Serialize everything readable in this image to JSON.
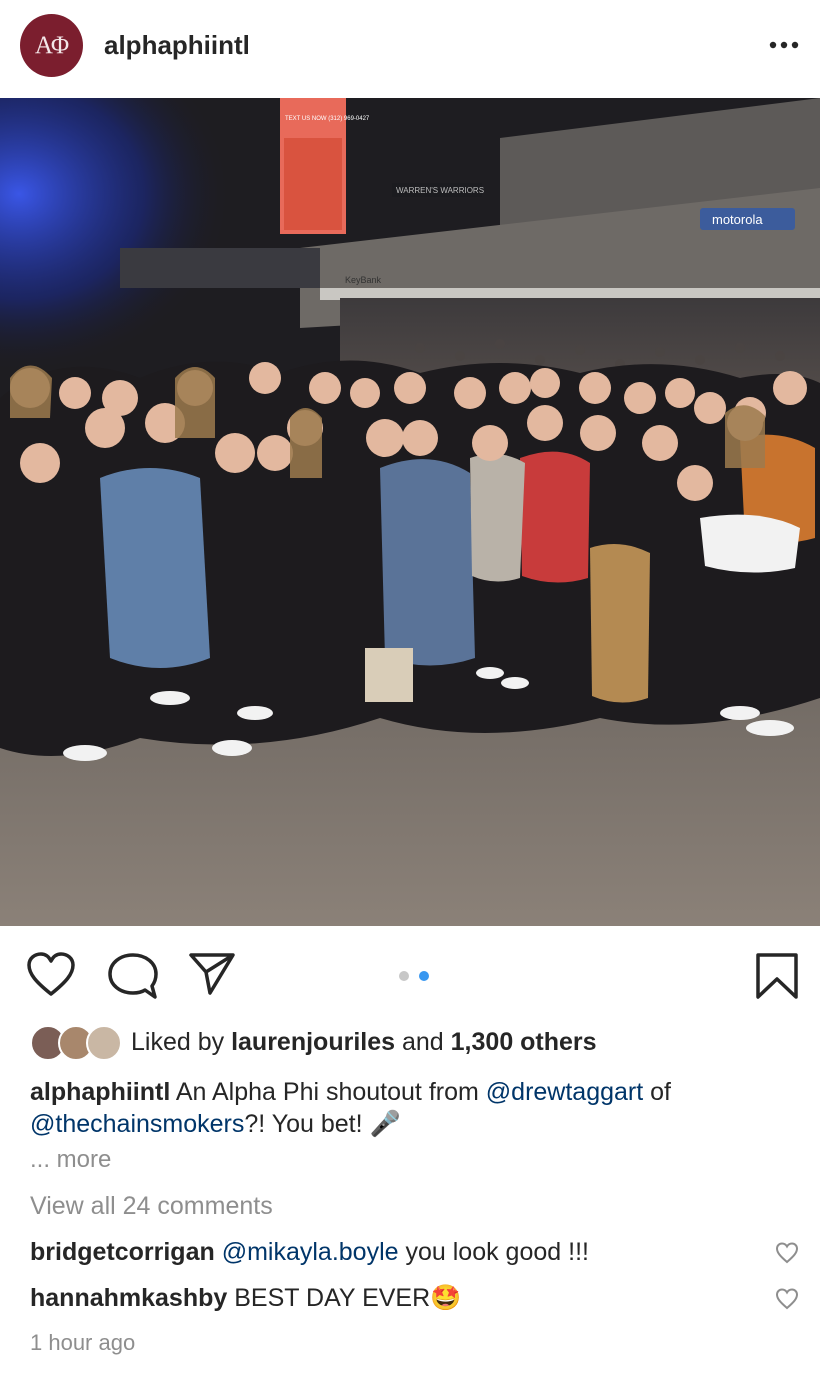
{
  "post": {
    "username": "alphaphiintl",
    "avatar_text": "ΑΦ",
    "more_icon": "more-horizontal-icon"
  },
  "photo": {
    "jumbotron_text": "TEXT US NOW (312) 969-0427",
    "banner_text": "WARREN'S WARRIORS",
    "sponsor_motorola": "motorola",
    "sponsor_keybank": "KeyBank"
  },
  "actions": {
    "like_icon": "heart-icon",
    "comment_icon": "comment-bubble-icon",
    "share_icon": "paper-plane-icon",
    "save_icon": "bookmark-icon",
    "carousel_total": 2,
    "carousel_current": 2
  },
  "likes": {
    "prefix": "Liked by",
    "user": "laurenjouriles",
    "and": "and",
    "count": "1,300 others"
  },
  "caption": {
    "username": "alphaphiintl",
    "text1": "An Alpha Phi shoutout from",
    "mention1": "@drewtaggart",
    "text2": "of",
    "mention2": "@thechainsmokers",
    "text3": "?! You bet!",
    "emoji": "🎤",
    "more": "... more"
  },
  "comments": {
    "view_all": "View all 24 comments",
    "items": [
      {
        "username": "bridgetcorrigan",
        "mention": "@mikayla.boyle",
        "text": "you look good !!!"
      },
      {
        "username": "hannahmkashby",
        "mention": "",
        "text": "BEST DAY EVER🤩"
      }
    ]
  },
  "timestamp": "1 hour ago",
  "colors": {
    "accent_blue": "#3897f0",
    "mention": "#003569",
    "secondary_text": "#8e8e8e",
    "brand_maroon": "#7b1e2e"
  }
}
